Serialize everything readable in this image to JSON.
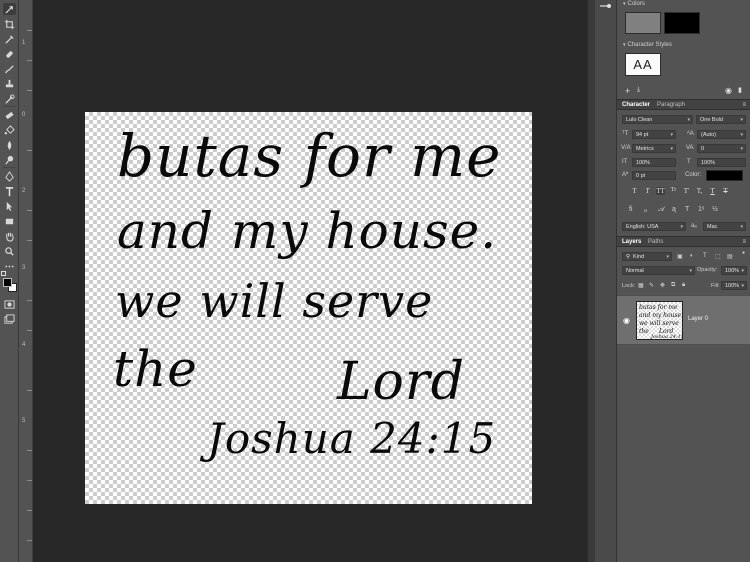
{
  "toolbar": {
    "tools": [
      "move-tool",
      "crop-tool",
      "eyedropper-tool",
      "healing-brush-tool",
      "brush-tool",
      "clone-stamp-tool",
      "history-brush-tool",
      "eraser-tool",
      "paint-bucket-tool",
      "blur-tool",
      "dodge-tool",
      "pen-tool",
      "type-tool",
      "path-selection-tool",
      "rectangle-tool",
      "hand-tool",
      "zoom-tool",
      "more-tools"
    ]
  },
  "ruler": {
    "marks": [
      "0",
      "1",
      "2",
      "3",
      "4",
      "5"
    ]
  },
  "canvas": {
    "lines": [
      "butas for me",
      "and my house.",
      "we will serve",
      "the",
      "Lord",
      "Joshua 24:15"
    ]
  },
  "panels": {
    "colors": {
      "title": "Colors",
      "foreground": "#808080",
      "background": "#000000"
    },
    "character_styles": {
      "title": "Character Styles",
      "preview": "AA"
    },
    "character": {
      "tab_character": "Character",
      "tab_paragraph": "Paragraph",
      "font_family": "Lulo Clean",
      "font_style": "One Bold",
      "size": "94 pt",
      "leading": "(Auto)",
      "kerning": "Metrics",
      "tracking": "0",
      "vscale": "100%",
      "hscale": "100%",
      "baseline": "0 pt",
      "color_label": "Color:",
      "text_color": "#000000",
      "style_buttons": [
        "T",
        "T",
        "TT",
        "Tr",
        "T'",
        "T,",
        "T",
        "T"
      ],
      "language": "English: USA",
      "antialias": "Mac"
    },
    "layers": {
      "tab_layers": "Layers",
      "tab_paths": "Paths",
      "filter_kind": "Kind",
      "blend_mode": "Normal",
      "opacity_label": "Opacity:",
      "opacity": "100%",
      "lock_label": "Lock:",
      "fill_label": "Fill:",
      "fill": "100%",
      "layer_name": "Layer 0"
    }
  }
}
